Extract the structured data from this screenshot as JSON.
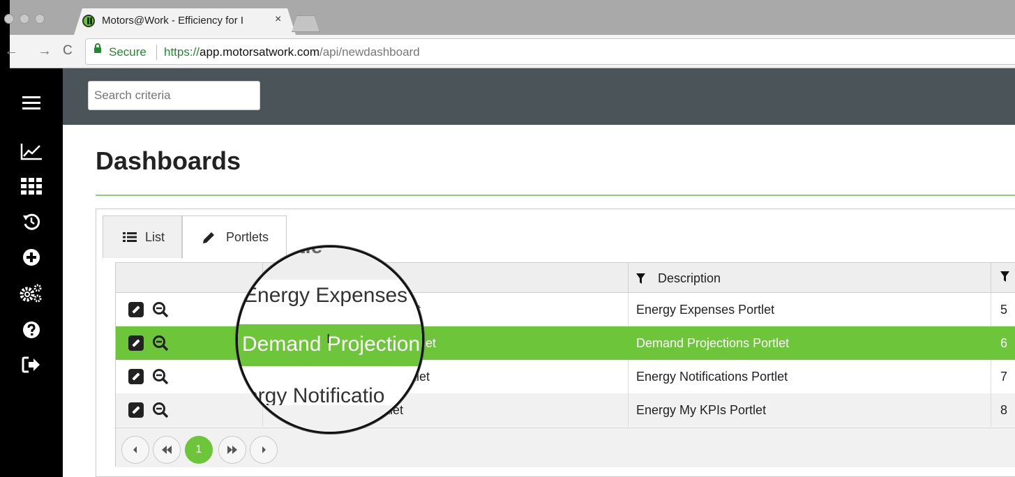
{
  "browser": {
    "tab_title": "Motors@Work - Efficiency for I",
    "tab_close": "×",
    "secure_label": "Secure",
    "url_scheme": "https://",
    "url_host": "app.motorsatwork.com",
    "url_path": "/api/newdashboard",
    "back_glyph": "←",
    "forward_glyph": "→",
    "reload_glyph": "C"
  },
  "sidebar": {
    "items": [
      {
        "icon": "hamburger-menu-icon"
      },
      {
        "icon": "line-chart-icon"
      },
      {
        "icon": "grid-icon"
      },
      {
        "icon": "history-icon"
      },
      {
        "icon": "plus-circle-icon"
      },
      {
        "icon": "gears-icon"
      },
      {
        "icon": "question-circle-icon"
      },
      {
        "icon": "sign-out-icon"
      }
    ]
  },
  "header": {
    "search_placeholder": "Search criteria"
  },
  "main": {
    "title": "Dashboards",
    "tabs": [
      {
        "label": "List",
        "icon": "list-icon"
      },
      {
        "label": "Portlets",
        "icon": "pencil-icon"
      }
    ],
    "grid": {
      "columns": [
        "Description"
      ],
      "rows": [
        {
          "title": "t",
          "description": "Energy Expenses Portlet",
          "id": "5",
          "selected": false
        },
        {
          "title": "let",
          "description": "Demand Projections Portlet",
          "id": "6",
          "selected": true
        },
        {
          "title": "rtlet",
          "description": "Energy Notifications Portlet",
          "id": "7",
          "selected": false
        },
        {
          "title": "rtlet",
          "description": "Energy My KPIs Portlet",
          "id": "8",
          "selected": false
        }
      ]
    },
    "pager": {
      "current_page": "1"
    }
  },
  "magnifier": {
    "header_fragment": "itle",
    "line1": "Energy Expenses",
    "line2": "Demand Projection",
    "line3": "ergy Notificatio"
  },
  "colors": {
    "accent_green": "#6dc53a",
    "header_bg": "#4b5458",
    "secure_green": "#1e8a2d"
  }
}
